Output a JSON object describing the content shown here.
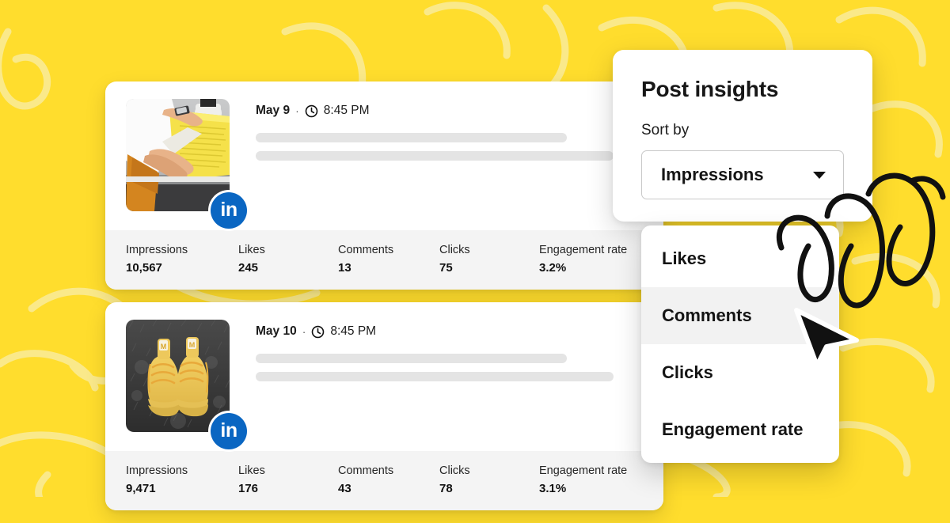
{
  "theme": {
    "background_color": "#FFDD2D",
    "doodle_color": "#FAE98A",
    "card_color": "#FFFFFF",
    "metrics_bar_color": "#F4F4F4",
    "linkedin_blue": "#0A66C2",
    "highlight_color": "#F2F2F2",
    "text_color": "#171717"
  },
  "feed": {
    "posts": [
      {
        "date": "May 9",
        "separator": "·",
        "time": "8:45 PM",
        "network": "linkedin",
        "network_badge_text": "in",
        "thumbnail_alt": "person-holding-yellow-newspaper",
        "metrics": [
          {
            "label": "Impressions",
            "value": "10,567"
          },
          {
            "label": "Likes",
            "value": "245"
          },
          {
            "label": "Comments",
            "value": "13"
          },
          {
            "label": "Clicks",
            "value": "75"
          },
          {
            "label": "Engagement rate",
            "value": "3.2%"
          }
        ]
      },
      {
        "date": "May 10",
        "separator": "·",
        "time": "8:45 PM",
        "network": "linkedin",
        "network_badge_text": "in",
        "thumbnail_alt": "yellow-sneakers-on-turf",
        "metrics": [
          {
            "label": "Impressions",
            "value": "9,471"
          },
          {
            "label": "Likes",
            "value": "176"
          },
          {
            "label": "Comments",
            "value": "43"
          },
          {
            "label": "Clicks",
            "value": "78"
          },
          {
            "label": "Engagement rate",
            "value": "3.1%"
          }
        ]
      }
    ]
  },
  "insights_panel": {
    "title": "Post insights",
    "sort_by_label": "Sort by",
    "selected_sort": "Impressions",
    "caret_icon": "chevron-down-icon"
  },
  "dropdown": {
    "options": [
      {
        "label": "Likes",
        "highlighted": false
      },
      {
        "label": "Comments",
        "highlighted": true
      },
      {
        "label": "Clicks",
        "highlighted": false
      },
      {
        "label": "Engagement rate",
        "highlighted": false
      }
    ]
  }
}
